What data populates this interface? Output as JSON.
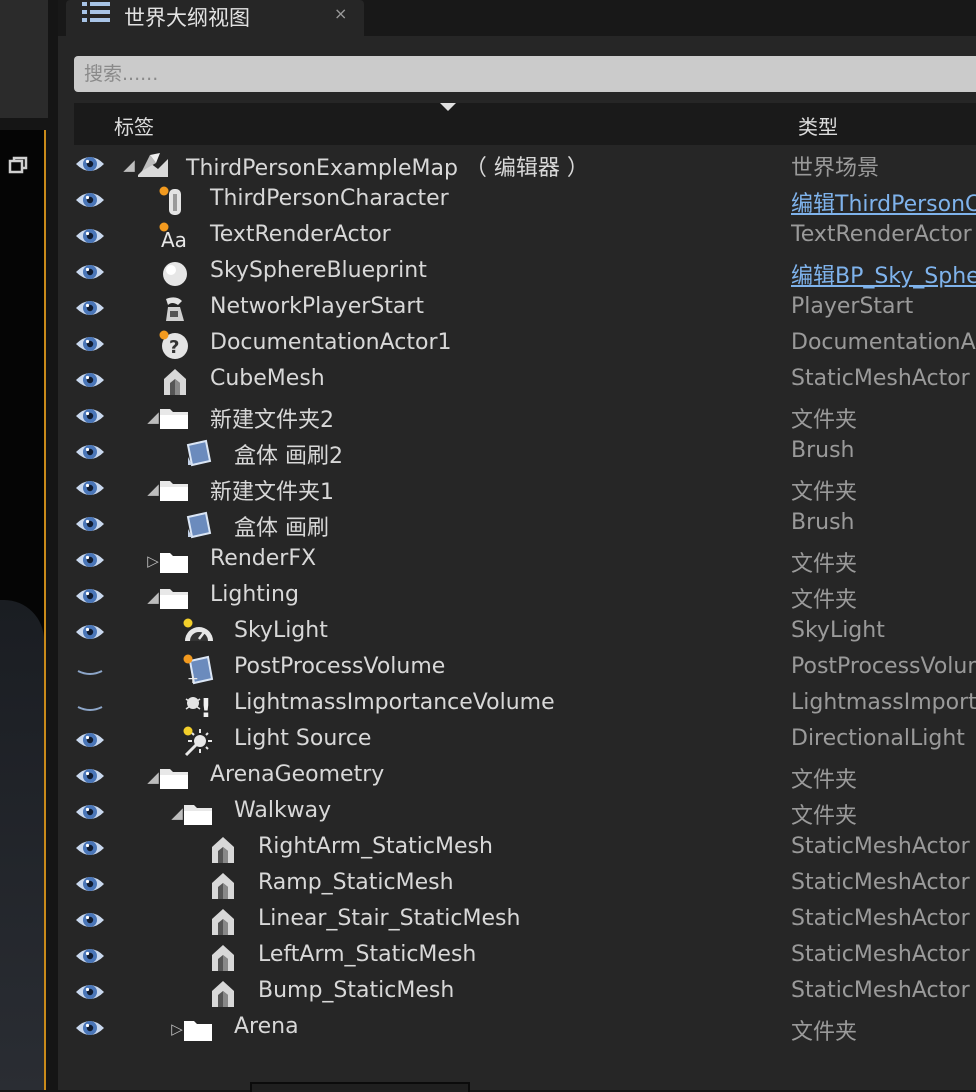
{
  "tab": {
    "title": "世界大纲视图",
    "close": "×"
  },
  "search": {
    "placeholder": "搜索......"
  },
  "header": {
    "label_col": "标签",
    "type_col": "类型"
  },
  "rows": [
    {
      "depth": 0,
      "arrow": "expanded",
      "icon": "level-icon",
      "name": "ThirdPersonExampleMap （ 编辑器 ）",
      "type": "世界场景",
      "link": false,
      "visible": true,
      "dot": ""
    },
    {
      "depth": 1,
      "arrow": "none",
      "icon": "character-icon",
      "name": "ThirdPersonCharacter",
      "type": "编辑ThirdPersonCharacter",
      "link": true,
      "visible": true,
      "dot": "orange"
    },
    {
      "depth": 1,
      "arrow": "none",
      "icon": "text-render-icon",
      "name": "TextRenderActor",
      "type": "TextRenderActor",
      "link": false,
      "visible": true,
      "dot": "orange"
    },
    {
      "depth": 1,
      "arrow": "none",
      "icon": "sphere-icon",
      "name": "SkySphereBlueprint",
      "type": "编辑BP_Sky_Sphere",
      "link": true,
      "visible": true,
      "dot": ""
    },
    {
      "depth": 1,
      "arrow": "none",
      "icon": "player-start-icon",
      "name": "NetworkPlayerStart",
      "type": "PlayerStart",
      "link": false,
      "visible": true,
      "dot": ""
    },
    {
      "depth": 1,
      "arrow": "none",
      "icon": "documentation-icon",
      "name": "DocumentationActor1",
      "type": "DocumentationActor",
      "link": false,
      "visible": true,
      "dot": "orange"
    },
    {
      "depth": 1,
      "arrow": "none",
      "icon": "static-mesh-icon",
      "name": "CubeMesh",
      "type": "StaticMeshActor",
      "link": false,
      "visible": true,
      "dot": ""
    },
    {
      "depth": 1,
      "arrow": "expanded",
      "icon": "folder-open-icon",
      "name": "新建文件夹2",
      "type": "文件夹",
      "link": false,
      "visible": true,
      "dot": ""
    },
    {
      "depth": 2,
      "arrow": "none",
      "icon": "brush-icon",
      "name": "盒体 画刷2",
      "type": "Brush",
      "link": false,
      "visible": true,
      "dot": ""
    },
    {
      "depth": 1,
      "arrow": "expanded",
      "icon": "folder-open-icon",
      "name": "新建文件夹1",
      "type": "文件夹",
      "link": false,
      "visible": true,
      "dot": ""
    },
    {
      "depth": 2,
      "arrow": "none",
      "icon": "brush-icon",
      "name": "盒体 画刷",
      "type": "Brush",
      "link": false,
      "visible": true,
      "dot": ""
    },
    {
      "depth": 1,
      "arrow": "collapsed",
      "icon": "folder-closed-icon",
      "name": "RenderFX",
      "type": "文件夹",
      "link": false,
      "visible": true,
      "dot": ""
    },
    {
      "depth": 1,
      "arrow": "expanded",
      "icon": "folder-open-icon",
      "name": "Lighting",
      "type": "文件夹",
      "link": false,
      "visible": true,
      "dot": ""
    },
    {
      "depth": 2,
      "arrow": "none",
      "icon": "sky-light-icon",
      "name": "SkyLight",
      "type": "SkyLight",
      "link": false,
      "visible": true,
      "dot": "yellow"
    },
    {
      "depth": 2,
      "arrow": "none",
      "icon": "post-process-icon",
      "name": "PostProcessVolume",
      "type": "PostProcessVolume",
      "link": false,
      "visible": false,
      "dot": "orange"
    },
    {
      "depth": 2,
      "arrow": "none",
      "icon": "lightmass-icon",
      "name": "LightmassImportanceVolume",
      "type": "LightmassImportanceVolume",
      "link": false,
      "visible": false,
      "dot": ""
    },
    {
      "depth": 2,
      "arrow": "none",
      "icon": "directional-light-icon",
      "name": "Light Source",
      "type": "DirectionalLight",
      "link": false,
      "visible": true,
      "dot": "yellow"
    },
    {
      "depth": 1,
      "arrow": "expanded",
      "icon": "folder-open-icon",
      "name": "ArenaGeometry",
      "type": "文件夹",
      "link": false,
      "visible": true,
      "dot": ""
    },
    {
      "depth": 2,
      "arrow": "expanded",
      "icon": "folder-open-icon",
      "name": "Walkway",
      "type": "文件夹",
      "link": false,
      "visible": true,
      "dot": ""
    },
    {
      "depth": 3,
      "arrow": "none",
      "icon": "static-mesh-icon",
      "name": "RightArm_StaticMesh",
      "type": "StaticMeshActor",
      "link": false,
      "visible": true,
      "dot": ""
    },
    {
      "depth": 3,
      "arrow": "none",
      "icon": "static-mesh-icon",
      "name": "Ramp_StaticMesh",
      "type": "StaticMeshActor",
      "link": false,
      "visible": true,
      "dot": ""
    },
    {
      "depth": 3,
      "arrow": "none",
      "icon": "static-mesh-icon",
      "name": "Linear_Stair_StaticMesh",
      "type": "StaticMeshActor",
      "link": false,
      "visible": true,
      "dot": ""
    },
    {
      "depth": 3,
      "arrow": "none",
      "icon": "static-mesh-icon",
      "name": "LeftArm_StaticMesh",
      "type": "StaticMeshActor",
      "link": false,
      "visible": true,
      "dot": ""
    },
    {
      "depth": 3,
      "arrow": "none",
      "icon": "static-mesh-icon",
      "name": "Bump_StaticMesh",
      "type": "StaticMeshActor",
      "link": false,
      "visible": true,
      "dot": ""
    },
    {
      "depth": 2,
      "arrow": "collapsed",
      "icon": "folder-closed-icon",
      "name": "Arena",
      "type": "文件夹",
      "link": false,
      "visible": true,
      "dot": ""
    }
  ]
}
